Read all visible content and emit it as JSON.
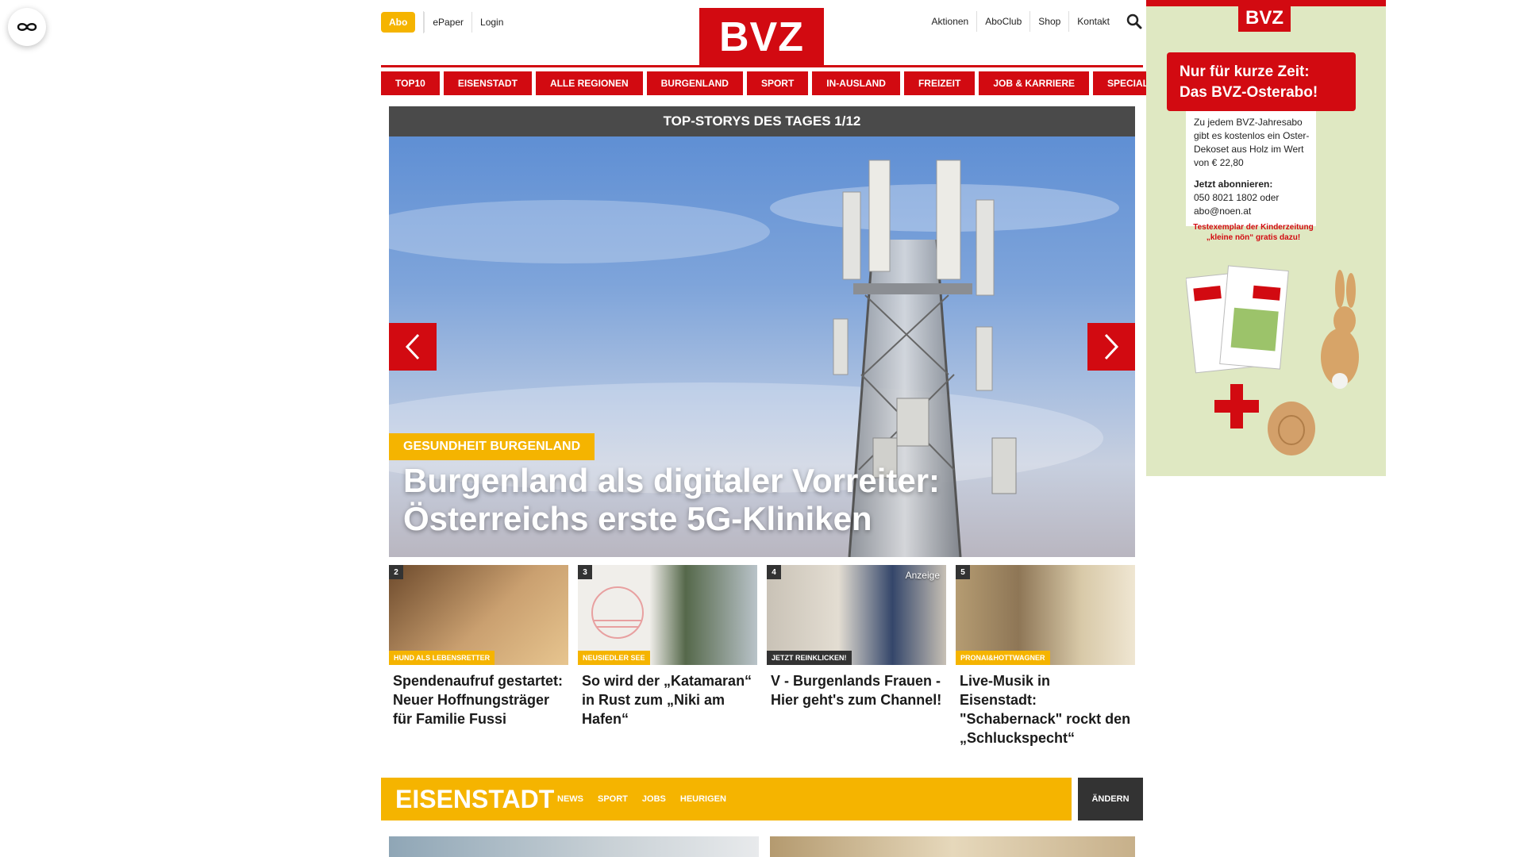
{
  "header": {
    "abo": "Abo",
    "left_links": [
      "ePaper",
      "Login"
    ],
    "logo": "BVZ",
    "right_links": [
      "Aktionen",
      "AboClub",
      "Shop",
      "Kontakt"
    ]
  },
  "nav": [
    "TOP10",
    "EISENSTADT",
    "ALLE REGIONEN",
    "BURGENLAND",
    "SPORT",
    "IN-AUSLAND",
    "FREIZEIT",
    "JOB & KARRIERE",
    "SPECIALS"
  ],
  "hero": {
    "bar_title": "TOP-STORYS DES TAGES 1/12",
    "tag": "GESUNDHEIT BURGENLAND",
    "headline": "Burgenland als digitaler Vorreiter: Österreichs erste 5G-Kliniken"
  },
  "cards": [
    {
      "num": "2",
      "tag": "HUND ALS LEBENSRETTER",
      "title": "Spendenaufruf gestartet: Neuer Hoffnungsträger für Familie Fussi",
      "img_colors": [
        "#7a5a3a",
        "#c9a074"
      ]
    },
    {
      "num": "3",
      "tag": "NEUSIEDLER SEE",
      "title": "So wird der „Katamaran“ in Rust zum „Niki am Hafen“",
      "img_colors": [
        "#e8ecef",
        "#556a4a"
      ]
    },
    {
      "num": "4",
      "tag": "JETZT REINKLICKEN!",
      "anzeige": "Anzeige",
      "title": "V - Burgenlands Frauen - Hier geht's zum Channel!",
      "img_colors": [
        "#d9d2c4",
        "#3a4a6a"
      ]
    },
    {
      "num": "5",
      "tag": "PRONAI&HOTTWAGNER",
      "title": "Live-Musik in Eisenstadt: \"Schabernack\" rockt den „Schluckspecht“",
      "img_colors": [
        "#c8b38c",
        "#6a5a48"
      ]
    }
  ],
  "section": {
    "title": "EISENSTADT",
    "links": [
      "NEWS",
      "SPORT",
      "JOBS",
      "HEURIGEN"
    ],
    "button": "ÄNDERN"
  },
  "ad": {
    "logo": "BVZ",
    "banner_line1": "Nur für kurze Zeit:",
    "banner_line2": "Das BVZ-Osterabo!",
    "body1": "Zu jedem BVZ-Jahresabo gibt es kostenlos ein Oster-Dekoset aus Holz im Wert von € 22,80",
    "body_heading": "Jetzt abonnieren:",
    "body2": "050 8021 1802 oder abo@noen.at",
    "small_line1": "Testexemplar der Kinderzeitung",
    "small_line2": "„kleine nön“ gratis dazu!"
  },
  "colors": {
    "brand_red": "#d20a11",
    "accent_yellow": "#f5b400",
    "dark": "#333333"
  }
}
